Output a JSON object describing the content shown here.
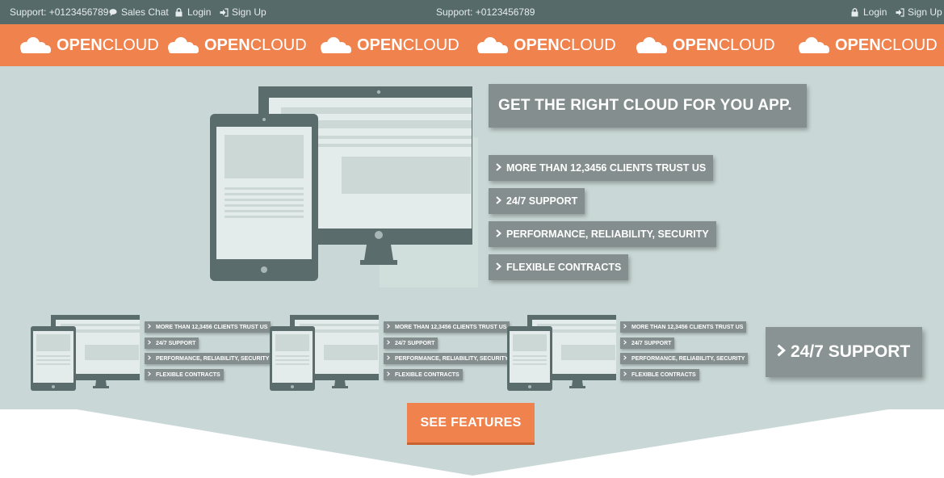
{
  "topbar": {
    "left": {
      "support": "Support: +0123456789",
      "sales_chat": "Sales Chat",
      "login": "Login",
      "signup": "Sign Up"
    },
    "center": {
      "support": "Support: +0123456789"
    },
    "right": {
      "login": "Login",
      "signup": "Sign Up"
    }
  },
  "brand": {
    "logo_bold": "OPEN",
    "logo_light": "CLOUD",
    "repeat_count_visible": 6
  },
  "hero": {
    "headline": "GET THE RIGHT CLOUD FOR YOU APP.",
    "features": [
      "MORE THAN 12,3456 CLIENTS TRUST US",
      "24/7 SUPPORT",
      "PERFORMANCE, RELIABILITY, SECURITY",
      "FLEXIBLE CONTRACTS"
    ],
    "support_badge": "24/7 SUPPORT",
    "cta": "SEE FEATURES"
  },
  "colors": {
    "topbar": "#566a6a",
    "brand": "#f0824d",
    "hero_bg": "#c9d8d6",
    "tag": "#858e8e",
    "device_dark": "#5a6c6b",
    "device_screen": "#e3ecea"
  }
}
